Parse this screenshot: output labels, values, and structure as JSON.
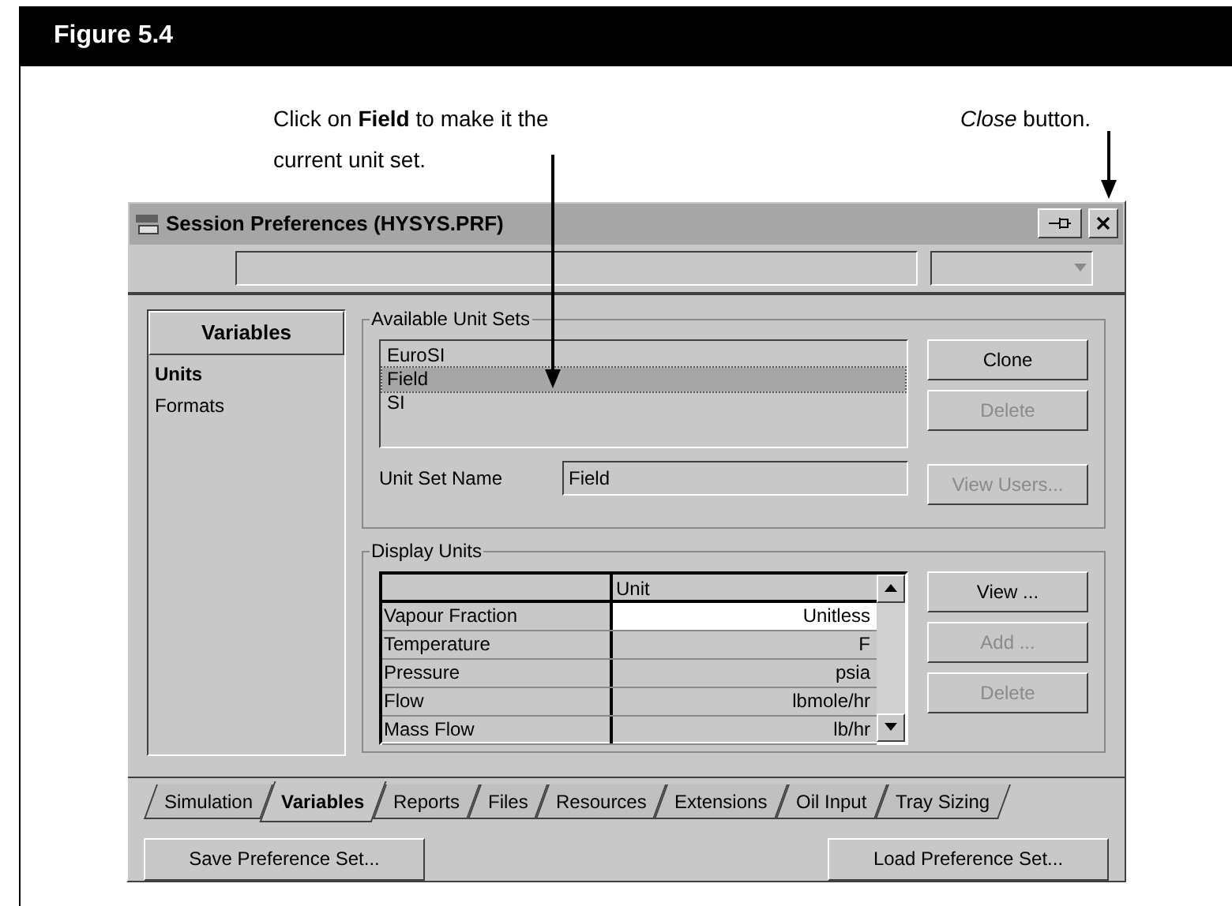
{
  "figure": {
    "title": "Figure 5.4"
  },
  "callouts": [
    {
      "kind": "plain",
      "text": "Click on **Field** to make it the current unit set."
    },
    {
      "kind": "emphasis",
      "text": "*Close* button."
    }
  ],
  "dialog": {
    "title": "Session Preferences (HYSYS.PRF)",
    "variables_panel": {
      "header": "Variables",
      "items": [
        {
          "label": "Units",
          "selected": true
        },
        {
          "label": "Formats",
          "selected": false
        }
      ]
    },
    "unit_sets": {
      "label": "Available Unit Sets",
      "items": [
        {
          "label": "EuroSI",
          "selected": false
        },
        {
          "label": "Field",
          "selected": true
        },
        {
          "label": "SI",
          "selected": false
        }
      ],
      "buttons": [
        {
          "label": "Clone",
          "disabled": false
        },
        {
          "label": "Delete",
          "disabled": true
        }
      ],
      "name_label": "Unit Set Name",
      "name_value": "Field",
      "view_users": {
        "label": "View Users...",
        "disabled": true
      }
    },
    "display_units": {
      "label": "Display Units",
      "column": "Unit",
      "rows": [
        {
          "name": "Vapour Fraction",
          "unit": "Unitless",
          "selected": true
        },
        {
          "name": "Temperature",
          "unit": "F",
          "selected": false
        },
        {
          "name": "Pressure",
          "unit": "psia",
          "selected": false
        },
        {
          "name": "Flow",
          "unit": "lbmole/hr",
          "selected": false
        },
        {
          "name": "Mass Flow",
          "unit": "lb/hr",
          "selected": false
        }
      ],
      "buttons": [
        {
          "label": "View ...",
          "disabled": false
        },
        {
          "label": "Add ...",
          "disabled": true
        },
        {
          "label": "Delete",
          "disabled": true
        }
      ]
    },
    "tabs": [
      {
        "label": "Simulation",
        "selected": false
      },
      {
        "label": "Variables",
        "selected": true
      },
      {
        "label": "Reports",
        "selected": false
      },
      {
        "label": "Files",
        "selected": false
      },
      {
        "label": "Resources",
        "selected": false
      },
      {
        "label": "Extensions",
        "selected": false
      },
      {
        "label": "Oil Input",
        "selected": false
      },
      {
        "label": "Tray Sizing",
        "selected": false
      }
    ],
    "bottom_buttons": [
      "Save Preference Set...",
      "Load Preference Set..."
    ]
  }
}
